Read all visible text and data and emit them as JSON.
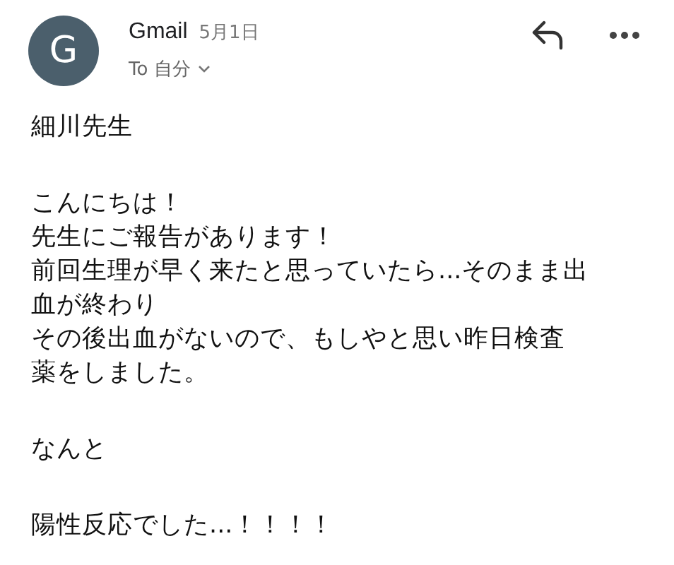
{
  "header": {
    "avatar_letter": "G",
    "sender": "Gmail",
    "date": "5月1日",
    "recipient": "To 自分"
  },
  "body": [
    [
      "細川先生"
    ],
    [
      "こんにちは！",
      "先生にご報告があります！",
      "前回生理が早く来たと思っていたら...そのまま出",
      "血が終わり",
      "その後出血がないので、もしやと思い昨日検査",
      "薬をしました。"
    ],
    [
      "なんと"
    ],
    [
      "陽性反応でした...！！！！"
    ]
  ]
}
